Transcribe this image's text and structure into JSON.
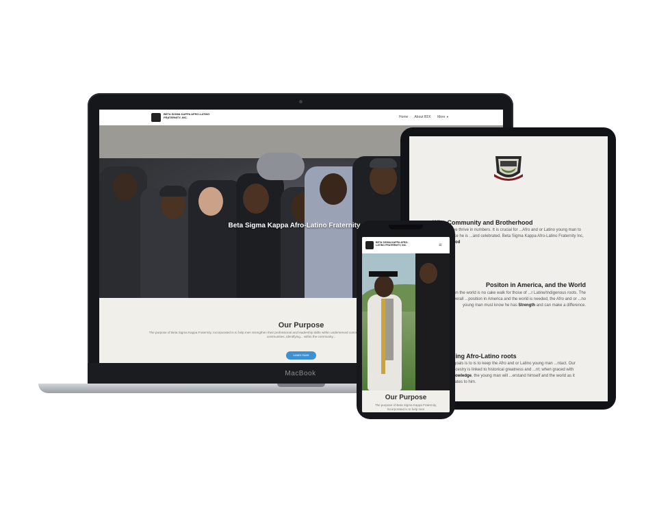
{
  "laptop": {
    "brand": "MacBook",
    "site": {
      "logo_text": "BETA SIGMA KAPPA AFRO-LATINO FRATERNITY, INC.",
      "nav": [
        "Home",
        "About BΣK",
        "More"
      ],
      "hero_title": "Beta Sigma Kappa Afro-Latino Fraternity Inc.",
      "purpose_title": "Our Purpose",
      "purpose_text": "The purpose of Beta Sigma Kappa Fraternity, Incorporated is to help men strengthen their professional and leadership skills within underserved communities. This is done by studying the links between African and Latino communities, identifying... within the community...",
      "learn_more": "Learn more"
    }
  },
  "tablet": {
    "sections": [
      {
        "title": "Why Community and Brotherhood",
        "text": "...beings of community, we thrive in numbers. It is crucial for ...Afro and or Latino young man to be able to reside in a place he is ...and celebrated. Beta Sigma Kappa Afro-Latino Fraternity Inc, ...this through",
        "bold": "Brotherhood"
      },
      {
        "title": "Positon in America, and the World",
        "text": "...ent times have shown the world is no cake walk for those of ...r Latine/Indigenous roots. The fight for equality and overall ...position in America and the world is needed, the Afro and or ...no young man must know he has",
        "bold": "Strength",
        "after": "and can make a difference."
      },
      {
        "title": "...ing Afro-Latino roots",
        "text": "...goals is to is to keep the Afro and or Latino young man ...ntact. Our Ancestry is linked to historical greatness and ...nt; when graced with",
        "bold": "knowledge",
        "after": ", the young man will ...erstand himself and the world as it relates to him."
      }
    ]
  },
  "phone": {
    "logo_text": "BETA SIGMA KAPPA AFRO-LATINO FRATERNITY, INC.",
    "menu_icon": "hamburger-icon",
    "purpose_title": "Our Purpose",
    "purpose_text": "The purpose of Beta Sigma Kappa Fraternity, Incorporated is to help men"
  }
}
